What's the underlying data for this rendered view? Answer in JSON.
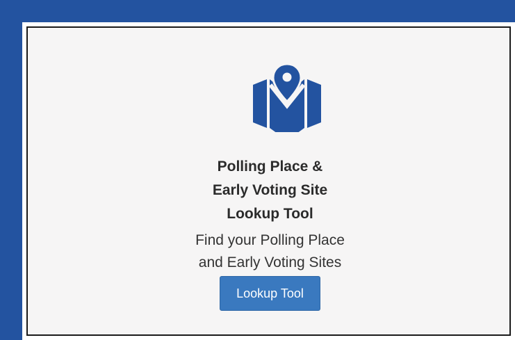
{
  "card": {
    "icon": "map-pin-icon",
    "title_line1": "Polling Place &",
    "title_line2": "Early Voting Site",
    "title_line3": "Lookup Tool",
    "subtitle_line1": "Find your Polling Place",
    "subtitle_line2": "and Early Voting Sites",
    "button_label": "Lookup Tool"
  },
  "colors": {
    "frame": "#2353a0",
    "icon": "#2353a0",
    "button": "#3a79bf",
    "card_background": "#f6f5f5"
  }
}
